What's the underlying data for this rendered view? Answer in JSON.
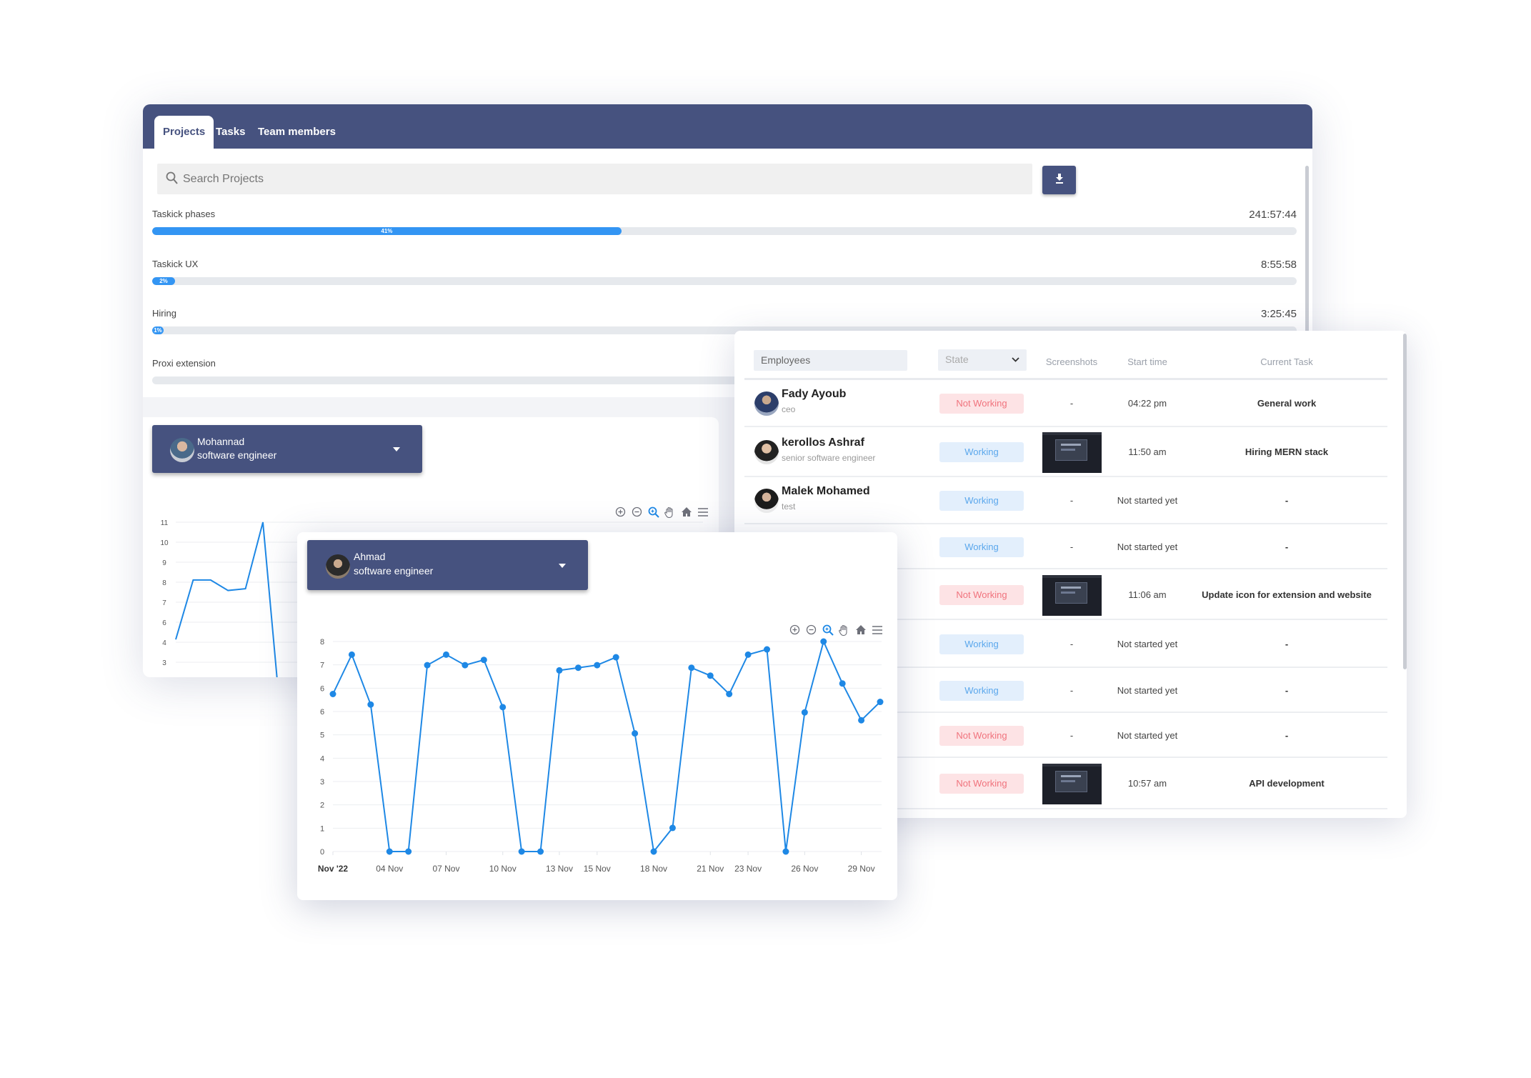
{
  "tabs": [
    {
      "label": "Projects",
      "active": true
    },
    {
      "label": "Tasks",
      "active": false
    },
    {
      "label": "Team members",
      "active": false
    }
  ],
  "search": {
    "placeholder": "Search Projects",
    "value": "",
    "icon": "search-icon"
  },
  "download_button": {
    "icon": "download-icon"
  },
  "projects": [
    {
      "name": "Taskick phases",
      "time": "241:57:44",
      "percent": 41,
      "label": "41%"
    },
    {
      "name": "Taskick UX",
      "time": "8:55:58",
      "percent": 2,
      "label": "2%"
    },
    {
      "name": "Hiring",
      "time": "3:25:45",
      "percent": 1,
      "label": "1%"
    },
    {
      "name": "Proxi extension",
      "time": "",
      "percent": 0,
      "label": ""
    }
  ],
  "toolbar_icons": [
    "zoom-in-icon",
    "zoom-out-icon",
    "selection-zoom-icon",
    "pan-hand-icon",
    "reset-home-icon",
    "menu-icon"
  ],
  "employees_table": {
    "filter_label": "Employees",
    "state_select": "State",
    "columns": [
      "Screenshots",
      "Start time",
      "Current Task"
    ],
    "status_colors": {
      "Not Working": "#f0737d",
      "Working": "#5aa7ec"
    },
    "rows": [
      {
        "name": "Fady Ayoub",
        "role": "ceo",
        "status": "Not Working",
        "screenshot": "-",
        "start": "04:22 pm",
        "task": "General work"
      },
      {
        "name": "kerollos Ashraf",
        "role": "senior software engineer",
        "status": "Working",
        "screenshot": "image",
        "start": "11:50 am",
        "task": "Hiring MERN stack"
      },
      {
        "name": "Malek Mohamed",
        "role": "test",
        "status": "Working",
        "screenshot": "-",
        "start": "Not started yet",
        "task": "-"
      },
      {
        "name": "",
        "role": "",
        "status": "Working",
        "screenshot": "-",
        "start": "Not started yet",
        "task": "-"
      },
      {
        "name": "",
        "role": "",
        "status": "Not Working",
        "screenshot": "image",
        "start": "11:06 am",
        "task": "Update icon for extension and website"
      },
      {
        "name": "",
        "role": "",
        "status": "Working",
        "screenshot": "-",
        "start": "Not started yet",
        "task": "-"
      },
      {
        "name": "",
        "role": "",
        "status": "Working",
        "screenshot": "-",
        "start": "Not started yet",
        "task": "-"
      },
      {
        "name": "",
        "role": "",
        "status": "Not Working",
        "screenshot": "-",
        "start": "Not started yet",
        "task": "-"
      },
      {
        "name": "",
        "role": "",
        "status": "Not Working",
        "screenshot": "image",
        "start": "10:57 am",
        "task": "API development"
      }
    ]
  },
  "mohannad_card": {
    "name": "Mohannad",
    "role": "software engineer"
  },
  "ahmad_card": {
    "name": "Ahmad",
    "role": "software engineer"
  },
  "colors": {
    "brand": "#46527f",
    "accent": "#3395f3",
    "line": "#1e88e5"
  },
  "chart_data": [
    {
      "type": "line",
      "title": "",
      "ylim": [
        3,
        11
      ],
      "yticks": [
        "11",
        "10",
        "9",
        "8",
        "7",
        "6",
        "4",
        "3"
      ],
      "values": [
        4.3,
        7.7,
        7.7,
        7.1,
        7.2,
        11,
        0
      ],
      "markers": false,
      "grid": true
    },
    {
      "type": "line",
      "title": "",
      "x": [
        1,
        2,
        3,
        4,
        5,
        6,
        7,
        8,
        9,
        10,
        11,
        12,
        13,
        14,
        15,
        16,
        17,
        18,
        19,
        20,
        21,
        22,
        23,
        24,
        25,
        26,
        27,
        28,
        29,
        30
      ],
      "values": [
        6.0,
        7.5,
        5.6,
        0,
        0,
        7.1,
        7.5,
        7.1,
        7.3,
        5.5,
        0,
        0,
        6.9,
        7.0,
        7.1,
        7.4,
        4.5,
        0,
        0.9,
        7.0,
        6.7,
        6.0,
        7.5,
        7.7,
        0,
        5.3,
        8.0,
        6.4,
        5.0,
        5.7
      ],
      "xticks": [
        {
          "day": 1,
          "label": "Nov '22"
        },
        {
          "day": 4,
          "label": "04 Nov"
        },
        {
          "day": 7,
          "label": "07 Nov"
        },
        {
          "day": 10,
          "label": "10 Nov"
        },
        {
          "day": 13,
          "label": "13 Nov"
        },
        {
          "day": 15,
          "label": "15 Nov"
        },
        {
          "day": 18,
          "label": "18 Nov"
        },
        {
          "day": 21,
          "label": "21 Nov"
        },
        {
          "day": 23,
          "label": "23 Nov"
        },
        {
          "day": 26,
          "label": "26 Nov"
        },
        {
          "day": 29,
          "label": "29 Nov"
        }
      ],
      "yticks": [
        "8",
        "7",
        "6",
        "6",
        "5",
        "4",
        "3",
        "2",
        "1",
        "0"
      ],
      "ylim": [
        0,
        8
      ],
      "markers": true,
      "grid": true
    }
  ]
}
